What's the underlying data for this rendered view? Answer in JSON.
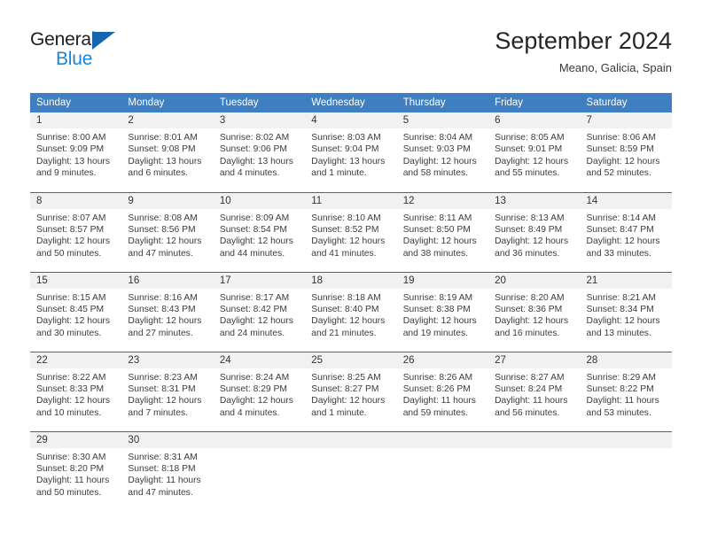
{
  "brand": {
    "name_top": "General",
    "name_bottom": "Blue",
    "accent_color": "#1b84d6",
    "triangle_color": "#1565b0"
  },
  "header": {
    "title": "September 2024",
    "subtitle": "Meano, Galicia, Spain"
  },
  "theme": {
    "header_row_bg": "#3f7fc1",
    "row_divider": "#2e6da8",
    "daynum_bg": "#f1f1f1",
    "text": "#333333"
  },
  "weekday_headers": [
    "Sunday",
    "Monday",
    "Tuesday",
    "Wednesday",
    "Thursday",
    "Friday",
    "Saturday"
  ],
  "weeks": [
    [
      {
        "day": "1",
        "sunrise": "Sunrise: 8:00 AM",
        "sunset": "Sunset: 9:09 PM",
        "daylight1": "Daylight: 13 hours",
        "daylight2": "and 9 minutes."
      },
      {
        "day": "2",
        "sunrise": "Sunrise: 8:01 AM",
        "sunset": "Sunset: 9:08 PM",
        "daylight1": "Daylight: 13 hours",
        "daylight2": "and 6 minutes."
      },
      {
        "day": "3",
        "sunrise": "Sunrise: 8:02 AM",
        "sunset": "Sunset: 9:06 PM",
        "daylight1": "Daylight: 13 hours",
        "daylight2": "and 4 minutes."
      },
      {
        "day": "4",
        "sunrise": "Sunrise: 8:03 AM",
        "sunset": "Sunset: 9:04 PM",
        "daylight1": "Daylight: 13 hours",
        "daylight2": "and 1 minute."
      },
      {
        "day": "5",
        "sunrise": "Sunrise: 8:04 AM",
        "sunset": "Sunset: 9:03 PM",
        "daylight1": "Daylight: 12 hours",
        "daylight2": "and 58 minutes."
      },
      {
        "day": "6",
        "sunrise": "Sunrise: 8:05 AM",
        "sunset": "Sunset: 9:01 PM",
        "daylight1": "Daylight: 12 hours",
        "daylight2": "and 55 minutes."
      },
      {
        "day": "7",
        "sunrise": "Sunrise: 8:06 AM",
        "sunset": "Sunset: 8:59 PM",
        "daylight1": "Daylight: 12 hours",
        "daylight2": "and 52 minutes."
      }
    ],
    [
      {
        "day": "8",
        "sunrise": "Sunrise: 8:07 AM",
        "sunset": "Sunset: 8:57 PM",
        "daylight1": "Daylight: 12 hours",
        "daylight2": "and 50 minutes."
      },
      {
        "day": "9",
        "sunrise": "Sunrise: 8:08 AM",
        "sunset": "Sunset: 8:56 PM",
        "daylight1": "Daylight: 12 hours",
        "daylight2": "and 47 minutes."
      },
      {
        "day": "10",
        "sunrise": "Sunrise: 8:09 AM",
        "sunset": "Sunset: 8:54 PM",
        "daylight1": "Daylight: 12 hours",
        "daylight2": "and 44 minutes."
      },
      {
        "day": "11",
        "sunrise": "Sunrise: 8:10 AM",
        "sunset": "Sunset: 8:52 PM",
        "daylight1": "Daylight: 12 hours",
        "daylight2": "and 41 minutes."
      },
      {
        "day": "12",
        "sunrise": "Sunrise: 8:11 AM",
        "sunset": "Sunset: 8:50 PM",
        "daylight1": "Daylight: 12 hours",
        "daylight2": "and 38 minutes."
      },
      {
        "day": "13",
        "sunrise": "Sunrise: 8:13 AM",
        "sunset": "Sunset: 8:49 PM",
        "daylight1": "Daylight: 12 hours",
        "daylight2": "and 36 minutes."
      },
      {
        "day": "14",
        "sunrise": "Sunrise: 8:14 AM",
        "sunset": "Sunset: 8:47 PM",
        "daylight1": "Daylight: 12 hours",
        "daylight2": "and 33 minutes."
      }
    ],
    [
      {
        "day": "15",
        "sunrise": "Sunrise: 8:15 AM",
        "sunset": "Sunset: 8:45 PM",
        "daylight1": "Daylight: 12 hours",
        "daylight2": "and 30 minutes."
      },
      {
        "day": "16",
        "sunrise": "Sunrise: 8:16 AM",
        "sunset": "Sunset: 8:43 PM",
        "daylight1": "Daylight: 12 hours",
        "daylight2": "and 27 minutes."
      },
      {
        "day": "17",
        "sunrise": "Sunrise: 8:17 AM",
        "sunset": "Sunset: 8:42 PM",
        "daylight1": "Daylight: 12 hours",
        "daylight2": "and 24 minutes."
      },
      {
        "day": "18",
        "sunrise": "Sunrise: 8:18 AM",
        "sunset": "Sunset: 8:40 PM",
        "daylight1": "Daylight: 12 hours",
        "daylight2": "and 21 minutes."
      },
      {
        "day": "19",
        "sunrise": "Sunrise: 8:19 AM",
        "sunset": "Sunset: 8:38 PM",
        "daylight1": "Daylight: 12 hours",
        "daylight2": "and 19 minutes."
      },
      {
        "day": "20",
        "sunrise": "Sunrise: 8:20 AM",
        "sunset": "Sunset: 8:36 PM",
        "daylight1": "Daylight: 12 hours",
        "daylight2": "and 16 minutes."
      },
      {
        "day": "21",
        "sunrise": "Sunrise: 8:21 AM",
        "sunset": "Sunset: 8:34 PM",
        "daylight1": "Daylight: 12 hours",
        "daylight2": "and 13 minutes."
      }
    ],
    [
      {
        "day": "22",
        "sunrise": "Sunrise: 8:22 AM",
        "sunset": "Sunset: 8:33 PM",
        "daylight1": "Daylight: 12 hours",
        "daylight2": "and 10 minutes."
      },
      {
        "day": "23",
        "sunrise": "Sunrise: 8:23 AM",
        "sunset": "Sunset: 8:31 PM",
        "daylight1": "Daylight: 12 hours",
        "daylight2": "and 7 minutes."
      },
      {
        "day": "24",
        "sunrise": "Sunrise: 8:24 AM",
        "sunset": "Sunset: 8:29 PM",
        "daylight1": "Daylight: 12 hours",
        "daylight2": "and 4 minutes."
      },
      {
        "day": "25",
        "sunrise": "Sunrise: 8:25 AM",
        "sunset": "Sunset: 8:27 PM",
        "daylight1": "Daylight: 12 hours",
        "daylight2": "and 1 minute."
      },
      {
        "day": "26",
        "sunrise": "Sunrise: 8:26 AM",
        "sunset": "Sunset: 8:26 PM",
        "daylight1": "Daylight: 11 hours",
        "daylight2": "and 59 minutes."
      },
      {
        "day": "27",
        "sunrise": "Sunrise: 8:27 AM",
        "sunset": "Sunset: 8:24 PM",
        "daylight1": "Daylight: 11 hours",
        "daylight2": "and 56 minutes."
      },
      {
        "day": "28",
        "sunrise": "Sunrise: 8:29 AM",
        "sunset": "Sunset: 8:22 PM",
        "daylight1": "Daylight: 11 hours",
        "daylight2": "and 53 minutes."
      }
    ],
    [
      {
        "day": "29",
        "sunrise": "Sunrise: 8:30 AM",
        "sunset": "Sunset: 8:20 PM",
        "daylight1": "Daylight: 11 hours",
        "daylight2": "and 50 minutes."
      },
      {
        "day": "30",
        "sunrise": "Sunrise: 8:31 AM",
        "sunset": "Sunset: 8:18 PM",
        "daylight1": "Daylight: 11 hours",
        "daylight2": "and 47 minutes."
      },
      {
        "day": "",
        "sunrise": "",
        "sunset": "",
        "daylight1": "",
        "daylight2": ""
      },
      {
        "day": "",
        "sunrise": "",
        "sunset": "",
        "daylight1": "",
        "daylight2": ""
      },
      {
        "day": "",
        "sunrise": "",
        "sunset": "",
        "daylight1": "",
        "daylight2": ""
      },
      {
        "day": "",
        "sunrise": "",
        "sunset": "",
        "daylight1": "",
        "daylight2": ""
      },
      {
        "day": "",
        "sunrise": "",
        "sunset": "",
        "daylight1": "",
        "daylight2": ""
      }
    ]
  ]
}
